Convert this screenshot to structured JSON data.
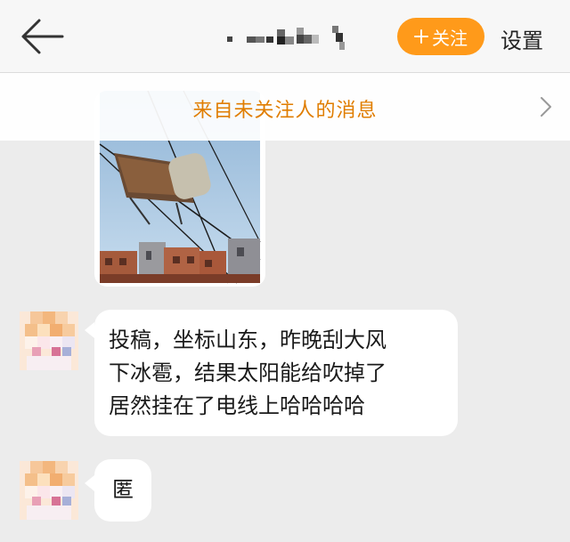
{
  "header": {
    "back_icon": "arrow-left-icon",
    "follow_button": {
      "icon": "plus-icon",
      "label": "关注"
    },
    "settings_label": "设置"
  },
  "banner": {
    "text": "来自未关注人的消息",
    "chevron_icon": "chevron-right-icon"
  },
  "messages": [
    {
      "type": "image",
      "description_icon": "photo"
    },
    {
      "type": "text",
      "lines": [
        "投稿，坐标山东，昨晚刮大风",
        "下冰雹，结果太阳能给吹掉了",
        "居然挂在了电线上哈哈哈哈"
      ]
    },
    {
      "type": "text",
      "lines": [
        "匿"
      ]
    }
  ],
  "colors": {
    "accent": "#ff9a1a",
    "banner_text": "#e07d00",
    "chat_background": "#ececec",
    "bubble": "#ffffff"
  }
}
